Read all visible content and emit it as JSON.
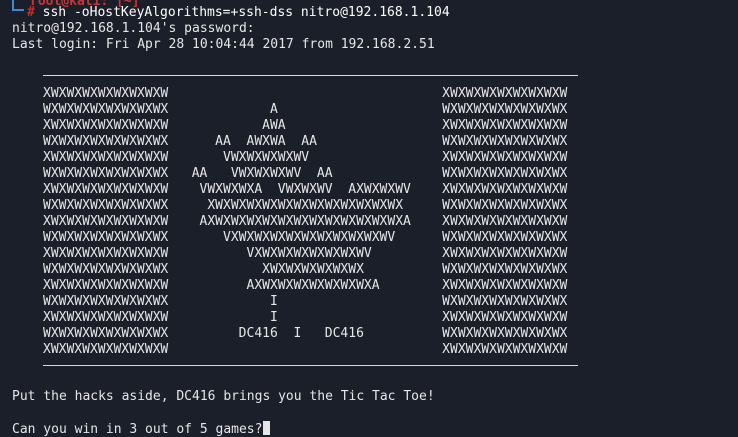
{
  "prompt": {
    "top_fragment": "root@kali: [~]",
    "symbol": "#",
    "command": "ssh -oHostKeyAlgorithms=+ssh-dss nitro@192.168.1.104"
  },
  "output": {
    "password_prompt": "nitro@192.168.1.104's password:",
    "last_login": "Last login: Fri Apr 28 10:04:44 2017 from 192.168.2.51",
    "art_lines": [
      "XWXWXWXWXWXWXWXW                                   XWXWXWXWXWXWXWXW",
      "WXWXWXWXWXWXWXWX             A                     WXWXWXWXWXWXWXWX",
      "XWXWXWXWXWXWXWXW            AWA                    XWXWXWXWXWXWXWXW",
      "WXWXWXWXWXWXWXWX      AA  AWXWA  AA                WXWXWXWXWXWXWXWX",
      "XWXWXWXWXWXWXWXW       VWXWXWXWXWV                 XWXWXWXWXWXWXWXW",
      "WXWXWXWXWXWXWXWX   AA   VWXWXWXWV  AA              WXWXWXWXWXWXWXWX",
      "XWXWXWXWXWXWXWXW    VWXWXWXA  VWXWXWV  AXWXWXWV    XWXWXWXWXWXWXWXW",
      "WXWXWXWXWXWXWXWX     XWXWXWXWXWXWXWXWXWXWXWXWX     WXWXWXWXWXWXWXWX",
      "XWXWXWXWXWXWXWXW    AXWXWXWXWXWXWXWXWXWXWXWXWXA    XWXWXWXWXWXWXWXW",
      "WXWXWXWXWXWXWXWX       VXWXWXWXWXWXWXWXWXWXWV      WXWXWXWXWXWXWXWX",
      "XWXWXWXWXWXWXWXW          VXWXWXWXWXWXWXWV         XWXWXWXWXWXWXWXW",
      "WXWXWXWXWXWXWXWX            XWXWXWXWXWXWX          WXWXWXWXWXWXWXWX",
      "XWXWXWXWXWXWXWXW          AXWXWXWXWXWXWXWXA        XWXWXWXWXWXWXWXW",
      "WXWXWXWXWXWXWXWX             I                     WXWXWXWXWXWXWXWX",
      "XWXWXWXWXWXWXWXW             I                     XWXWXWXWXWXWXWXW",
      "WXWXWXWXWXWXWXWX         DC416  I   DC416          WXWXWXWXWXWXWXWX",
      "XWXWXWXWXWXWXWXW                                   XWXWXWXWXWXWXWXW"
    ],
    "message": "Put the hacks aside, DC416 brings you the Tic Tac Toe!",
    "question": "Can you win in 3 out of 5 games?"
  },
  "colors": {
    "background": "#1b1f2a",
    "text": "#e6e6e6",
    "prompt_hash": "#cc2b2b",
    "prompt_frame": "#3a8ad6"
  }
}
